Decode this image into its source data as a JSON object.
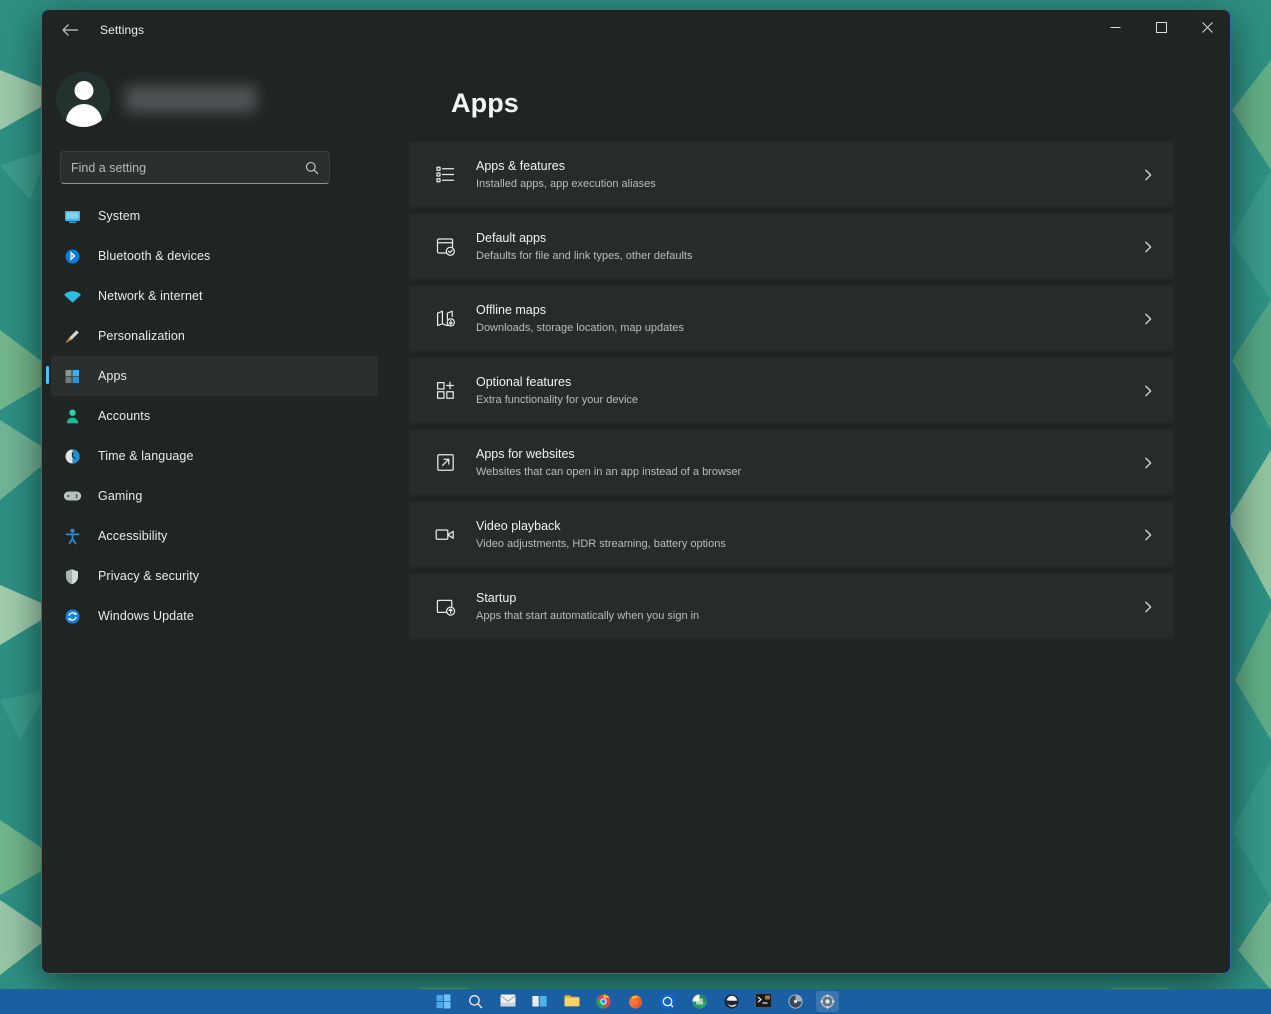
{
  "wallpaper": {
    "base_color": "#2e9184",
    "triangle_color": "#a8d49d"
  },
  "window": {
    "title": "Settings",
    "back_icon": "back-arrow-icon",
    "controls": [
      {
        "name": "minimize-button",
        "glyph": "minimize-icon"
      },
      {
        "name": "maximize-button",
        "glyph": "maximize-icon"
      },
      {
        "name": "close-button",
        "glyph": "close-icon"
      }
    ]
  },
  "account": {
    "name_redacted": ""
  },
  "search": {
    "placeholder": "Find a setting",
    "value": "",
    "icon": "search-icon"
  },
  "sidebar": {
    "items": [
      {
        "label": "System",
        "icon": "monitor-icon",
        "selected": false
      },
      {
        "label": "Bluetooth & devices",
        "icon": "bluetooth-icon",
        "selected": false
      },
      {
        "label": "Network & internet",
        "icon": "wifi-icon",
        "selected": false
      },
      {
        "label": "Personalization",
        "icon": "paintbrush-icon",
        "selected": false
      },
      {
        "label": "Apps",
        "icon": "apps-grid-icon",
        "selected": true
      },
      {
        "label": "Accounts",
        "icon": "person-icon",
        "selected": false
      },
      {
        "label": "Time & language",
        "icon": "clock-icon",
        "selected": false
      },
      {
        "label": "Gaming",
        "icon": "gamepad-icon",
        "selected": false
      },
      {
        "label": "Accessibility",
        "icon": "accessibility-icon",
        "selected": false
      },
      {
        "label": "Privacy & security",
        "icon": "shield-icon",
        "selected": false
      },
      {
        "label": "Windows Update",
        "icon": "refresh-icon",
        "selected": false
      }
    ]
  },
  "main": {
    "title": "Apps",
    "cards": [
      {
        "title": "Apps & features",
        "subtitle": "Installed apps, app execution aliases",
        "icon": "list-icon"
      },
      {
        "title": "Default apps",
        "subtitle": "Defaults for file and link types, other defaults",
        "icon": "default-apps-icon"
      },
      {
        "title": "Offline maps",
        "subtitle": "Downloads, storage location, map updates",
        "icon": "map-download-icon"
      },
      {
        "title": "Optional features",
        "subtitle": "Extra functionality for your device",
        "icon": "grid-plus-icon"
      },
      {
        "title": "Apps for websites",
        "subtitle": "Websites that can open in an app instead of a browser",
        "icon": "external-link-icon"
      },
      {
        "title": "Video playback",
        "subtitle": "Video adjustments, HDR streaming, battery options",
        "icon": "video-camera-icon"
      },
      {
        "title": "Startup",
        "subtitle": "Apps that start automatically when you sign in",
        "icon": "startup-icon"
      }
    ],
    "chevron_icon": "chevron-right-icon"
  },
  "taskbar": {
    "background_color": "#1b5fa3",
    "items": [
      {
        "name": "start-button",
        "icon": "windows-logo-icon",
        "active": false
      },
      {
        "name": "search-taskbar-button",
        "icon": "search-circle-icon",
        "active": false
      },
      {
        "name": "mail-taskbar-button",
        "icon": "mail-icon",
        "active": false
      },
      {
        "name": "widgets-taskbar-button",
        "icon": "widgets-icon",
        "active": false
      },
      {
        "name": "file-explorer-taskbar-button",
        "icon": "folder-icon",
        "active": false
      },
      {
        "name": "chrome-taskbar-button",
        "icon": "chrome-icon",
        "active": false
      },
      {
        "name": "firefox-taskbar-button",
        "icon": "firefox-icon",
        "active": false
      },
      {
        "name": "cortana-taskbar-button",
        "icon": "cortana-icon",
        "active": false
      },
      {
        "name": "excel-taskbar-button",
        "icon": "excel-icon",
        "active": false
      },
      {
        "name": "edge-taskbar-button",
        "icon": "edge-dark-icon",
        "active": false
      },
      {
        "name": "terminal-taskbar-button",
        "icon": "terminal-icon",
        "active": false
      },
      {
        "name": "media-taskbar-button",
        "icon": "media-icon",
        "active": false
      },
      {
        "name": "settings-taskbar-button",
        "icon": "settings-gear-icon",
        "active": true
      }
    ]
  }
}
